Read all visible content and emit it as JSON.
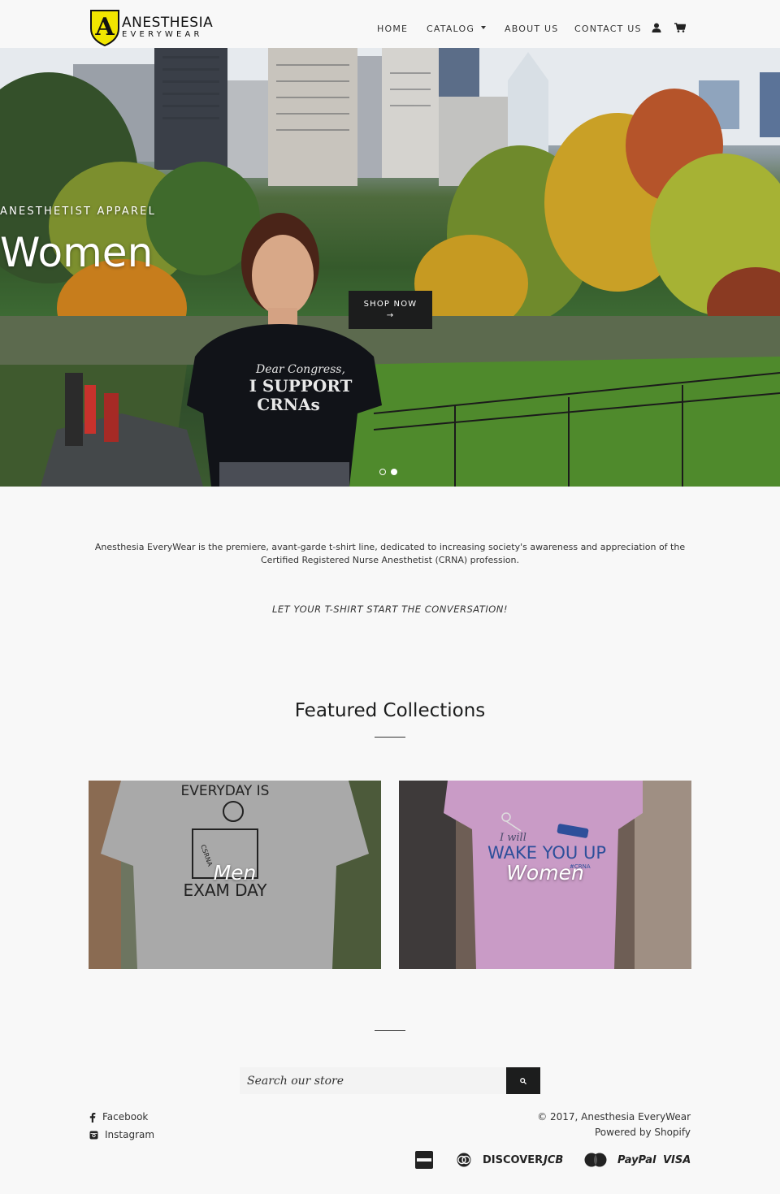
{
  "header": {
    "logo_line1": "ANESTHESIA",
    "logo_line2": "EVERYWEAR",
    "nav": {
      "home": "HOME",
      "catalog": "CATALOG",
      "about": "ABOUT US",
      "contact": "CONTACT US"
    }
  },
  "hero": {
    "kicker": "ANESTHETIST APPAREL",
    "title": "Women",
    "button_label": "SHOP NOW",
    "button_arrow": "→",
    "slides_total": 2,
    "active_slide": 2
  },
  "intro": {
    "text": "Anesthesia EveryWear is the premiere, avant-garde t-shirt line, dedicated to increasing society's awareness and appreciation of the Certified Registered Nurse Anesthetist (CRNA) profession.",
    "tagline": "LET YOUR T-SHIRT START THE CONVERSATION!"
  },
  "featured": {
    "title": "Featured Collections",
    "collections": [
      {
        "label": "Men",
        "shirt_top": "EVERYDAY IS",
        "shirt_bottom": "EXAM DAY",
        "shirt_desk": "CSRNA"
      },
      {
        "label": "Women",
        "shirt_script": "I will",
        "shirt_main": "WAKE YOU UP",
        "shirt_tag": "#CRNA"
      }
    ]
  },
  "footer": {
    "search_placeholder": "Search our store",
    "social": {
      "facebook": "Facebook",
      "instagram": "Instagram"
    },
    "copyright": "© 2017, Anesthesia EveryWear",
    "powered": "Powered by Shopify",
    "payments": {
      "discover": "DISCOVER",
      "jcb": "JCB",
      "paypal": "PayPal",
      "visa": "VISA"
    }
  },
  "colors": {
    "background": "#f8f8f8",
    "dark_button": "#1c1d1d",
    "logo_yellow": "#f2e600"
  }
}
